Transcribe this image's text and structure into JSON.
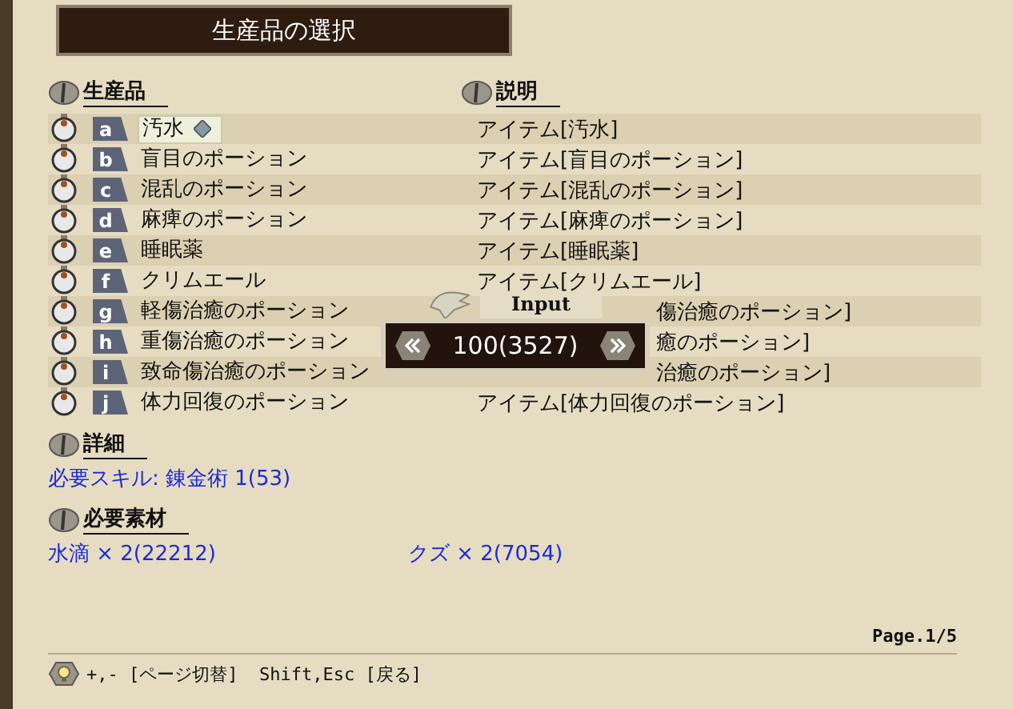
{
  "window": {
    "title": "生産品の選択"
  },
  "products": {
    "heading": "生産品",
    "items": [
      {
        "key": "a",
        "name": "汚水",
        "selected": true
      },
      {
        "key": "b",
        "name": "盲目のポーション",
        "selected": false
      },
      {
        "key": "c",
        "name": "混乱のポーション",
        "selected": false
      },
      {
        "key": "d",
        "name": "麻痺のポーション",
        "selected": false
      },
      {
        "key": "e",
        "name": "睡眠薬",
        "selected": false
      },
      {
        "key": "f",
        "name": "クリムエール",
        "selected": false
      },
      {
        "key": "g",
        "name": "軽傷治癒のポーション",
        "selected": false
      },
      {
        "key": "h",
        "name": "重傷治癒のポーション",
        "selected": false
      },
      {
        "key": "i",
        "name": "致命傷治癒のポーション",
        "selected": false
      },
      {
        "key": "j",
        "name": "体力回復のポーション",
        "selected": false
      }
    ]
  },
  "descriptions": {
    "heading": "説明",
    "items": [
      {
        "text": "アイテム[汚水]",
        "kind": "full"
      },
      {
        "text": "アイテム[盲目のポーション]",
        "kind": "full"
      },
      {
        "text": "アイテム[混乱のポーション]",
        "kind": "full"
      },
      {
        "text": "アイテム[麻痺のポーション]",
        "kind": "full"
      },
      {
        "text": "アイテム[睡眠薬]",
        "kind": "full"
      },
      {
        "text": "アイテム[クリムエール]",
        "kind": "full"
      },
      {
        "text": "傷治癒のポーション]",
        "kind": "partial"
      },
      {
        "text": "癒のポーション]",
        "kind": "partial"
      },
      {
        "text": "治癒のポーション]",
        "kind": "partial"
      },
      {
        "text": "アイテム[体力回復のポーション]",
        "kind": "full"
      }
    ]
  },
  "details": {
    "heading": "詳細",
    "text": "必要スキル: 錬金術 1(53)"
  },
  "materials": {
    "heading": "必要素材",
    "items": [
      "水滴 × 2(22212)",
      "クズ × 2(7054)"
    ]
  },
  "input_dialog": {
    "label": "Input",
    "value": "100(3527)"
  },
  "page": "Page.1/5",
  "hint": "+,- [ページ切替]  Shift,Esc [戻る]"
}
